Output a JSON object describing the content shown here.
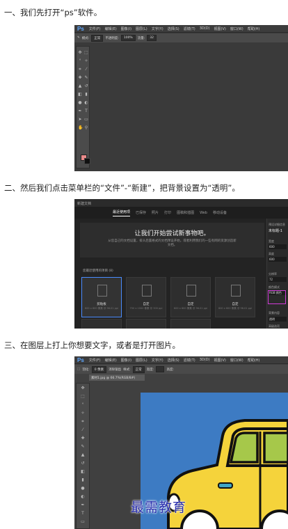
{
  "steps": [
    {
      "text": "一、我们先打开“ps”软件。"
    },
    {
      "text": "二、然后我们点击菜单栏的“文件”-“新建”，把背景设置为“透明”。"
    },
    {
      "text": "三、在图层上打上你想要文字，或者是打开图片。"
    }
  ],
  "shot1": {
    "app_logo": "Ps",
    "menu": [
      "文件(F)",
      "编辑(E)",
      "图像(I)",
      "图层(L)",
      "文字(Y)",
      "选择(S)",
      "滤镜(T)",
      "3D(D)",
      "视图(V)",
      "窗口(W)",
      "帮助(H)"
    ],
    "options": {
      "mode_label": "模式:",
      "mode_value": "正常",
      "opacity_label": "不透明度:",
      "opacity_value": "100%",
      "flow_label": "流量:",
      "flow_value": "32"
    }
  },
  "shot2": {
    "window_title": "新建文档",
    "tabs": [
      "最近使用项",
      "已保存",
      "照片",
      "打印",
      "图稿和插图",
      "Web",
      "移动设备"
    ],
    "hero_title": "让我们开始尝试新事物吧。",
    "hero_subtitle": "从您自己的文档设置，排头后置格式的文档预设开始，或者利用我们的一些有网的资源创造新文档。",
    "presets_label": "您最近使用的项目 (8)",
    "presets": [
      {
        "name": "剪贴板",
        "dims": "600 x 600 像素 @ 96.01 ppi"
      },
      {
        "name": "自定",
        "dims": "750 x 1000 像素 @ 300 ppi"
      },
      {
        "name": "自定",
        "dims": "600 x 600 像素 @ 96.01 ppi"
      },
      {
        "name": "自定",
        "dims": "600 x 600 像素 @ 96.01 ppi"
      }
    ],
    "panel": {
      "heading": "预设详细信息",
      "doc_name": "未标题-1",
      "width_label": "宽度",
      "width_value": "600",
      "height_label": "高度",
      "height_value": "600",
      "resolution_label": "分辨率",
      "resolution_value": "72",
      "color_mode_label": "颜色模式",
      "color_mode_value": "RGB 颜色",
      "background_label": "背景内容",
      "background_value": "透明",
      "advanced_label": "高级选项"
    }
  },
  "shot3": {
    "app_logo": "Ps",
    "menu": [
      "文件(F)",
      "编辑(E)",
      "图像(I)",
      "图层(L)",
      "文字(Y)",
      "选择(S)",
      "滤镜(T)",
      "3D(D)",
      "视图(V)",
      "窗口(W)",
      "帮助(H)"
    ],
    "options": {
      "feather_label": "羽化:",
      "feather_value": "0 像素",
      "antialias": "消除锯齿",
      "style_label": "样式:",
      "style_value": "正常",
      "width_label": "宽度:",
      "height_label": "高度:"
    },
    "document_tab": "素材1.jpg @ 66.7%(RGB/8#)"
  },
  "watermark": "最需教育",
  "colors": {
    "ps_blue": "#5fa8ff",
    "canvas_blue": "#3d7bc3",
    "car_yellow": "#f5d33b",
    "window_green": "#a6c84a",
    "highlight_magenta": "#d23ad8",
    "swatch_fg": "#e98a8a"
  }
}
